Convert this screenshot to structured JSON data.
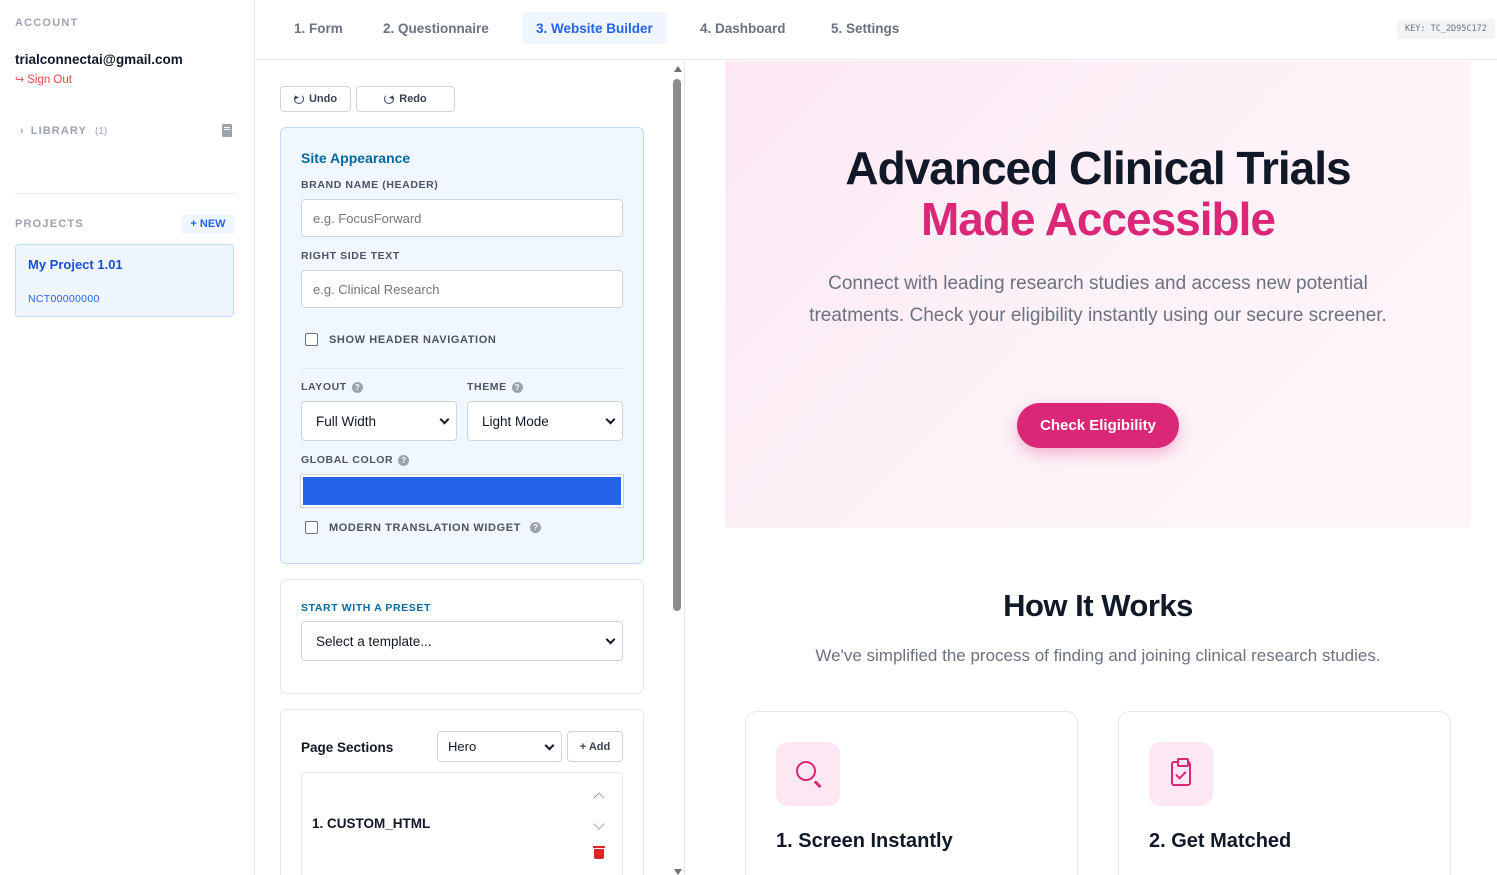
{
  "account": {
    "section_label": "ACCOUNT",
    "email": "trialconnectai@gmail.com",
    "sign_out": "Sign Out"
  },
  "library": {
    "label": "LIBRARY",
    "count": "(1)"
  },
  "projects": {
    "section_label": "PROJECTS",
    "new_label": "+ NEW",
    "items": [
      {
        "name": "My Project 1.01",
        "id": "NCT00000000"
      }
    ]
  },
  "tabs": [
    {
      "label": "1. Form",
      "active": false
    },
    {
      "label": "2. Questionnaire",
      "active": false
    },
    {
      "label": "3. Website Builder",
      "active": true
    },
    {
      "label": "4. Dashboard",
      "active": false
    },
    {
      "label": "5. Settings",
      "active": false
    }
  ],
  "key_badge": "KEY: TC_2D95C172",
  "editor": {
    "undo_label": "Undo",
    "redo_label": "Redo",
    "appearance": {
      "title": "Site Appearance",
      "brand_label": "BRAND NAME (HEADER)",
      "brand_placeholder": "e.g. FocusForward",
      "right_text_label": "RIGHT SIDE TEXT",
      "right_text_placeholder": "e.g. Clinical Research",
      "show_nav_label": "SHOW HEADER NAVIGATION",
      "show_nav_checked": false,
      "layout_label": "LAYOUT",
      "layout_value": "Full Width",
      "theme_label": "THEME",
      "theme_value": "Light Mode",
      "global_color_label": "GLOBAL COLOR",
      "global_color": "#2563eb",
      "translation_label": "MODERN TRANSLATION WIDGET",
      "translation_checked": false
    },
    "preset": {
      "label": "START WITH A PRESET",
      "value": "Select a template..."
    },
    "sections": {
      "title": "Page Sections",
      "type_value": "Hero",
      "add_label": "+ Add",
      "items": [
        {
          "name": "1. CUSTOM_HTML"
        }
      ]
    }
  },
  "preview": {
    "hero": {
      "title_line1": "Advanced Clinical Trials",
      "title_line2": "Made Accessible",
      "subtitle": "Connect with leading research studies and access new potential treatments. Check your eligibility instantly using our secure screener.",
      "cta": "Check Eligibility",
      "accent_color": "#db2777"
    },
    "how_it_works": {
      "title": "How It Works",
      "subtitle": "We've simplified the process of finding and joining clinical research studies.",
      "steps": [
        {
          "title": "1. Screen Instantly",
          "icon": "search-icon"
        },
        {
          "title": "2. Get Matched",
          "icon": "clipboard-check-icon"
        }
      ]
    }
  }
}
